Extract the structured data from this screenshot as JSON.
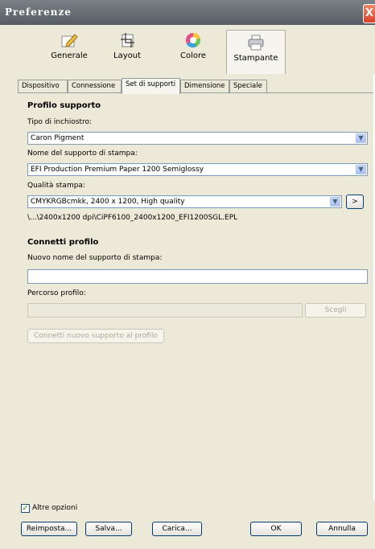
{
  "window": {
    "title": "Preferenze",
    "close_label": "X"
  },
  "toolbar": {
    "items": [
      {
        "label": "Generale",
        "icon": "pencil-edit-icon"
      },
      {
        "label": "Layout",
        "icon": "layout-crop-icon"
      },
      {
        "label": "Colore",
        "icon": "color-wheel-icon"
      },
      {
        "label": "Stampante",
        "icon": "printer-icon",
        "selected": true
      }
    ]
  },
  "tabs": [
    {
      "label": "Dispositivo"
    },
    {
      "label": "Connessione"
    },
    {
      "label": "Set di supporti",
      "selected": true
    },
    {
      "label": "Dimensione"
    },
    {
      "label": "Speciale"
    }
  ],
  "media_profile": {
    "section_title": "Profilo supporto",
    "ink_type_label": "Tipo di inchiostro:",
    "ink_type_value": "Caron Pigment",
    "media_name_label": "Nome del supporto di stampa:",
    "media_name_value": "EFI Production Premium Paper 1200 Semiglossy",
    "quality_label": "Qualità stampa:",
    "quality_value": "CMYKRGBcmkk, 2400 x 1200, High quality",
    "quality_more_button": ">",
    "profile_path": "\\...\\2400x1200 dpi\\CiPF6100_2400x1200_EFI1200SGL.EPL"
  },
  "connect_profile": {
    "section_title": "Connetti profilo",
    "new_media_name_label": "Nuovo nome del supporto di stampa:",
    "new_media_name_value": "",
    "profile_path_label": "Percorso profilo:",
    "profile_path_value": "",
    "choose_button": "Scegli",
    "connect_button": "Connetti nuovo supporto al profilo"
  },
  "footer": {
    "more_options_label": "Altre opzioni",
    "more_options_checked": true,
    "reset_button": "Reimposta...",
    "save_button": "Salva...",
    "load_button": "Carica...",
    "ok_button": "OK",
    "cancel_button": "Annulla"
  }
}
